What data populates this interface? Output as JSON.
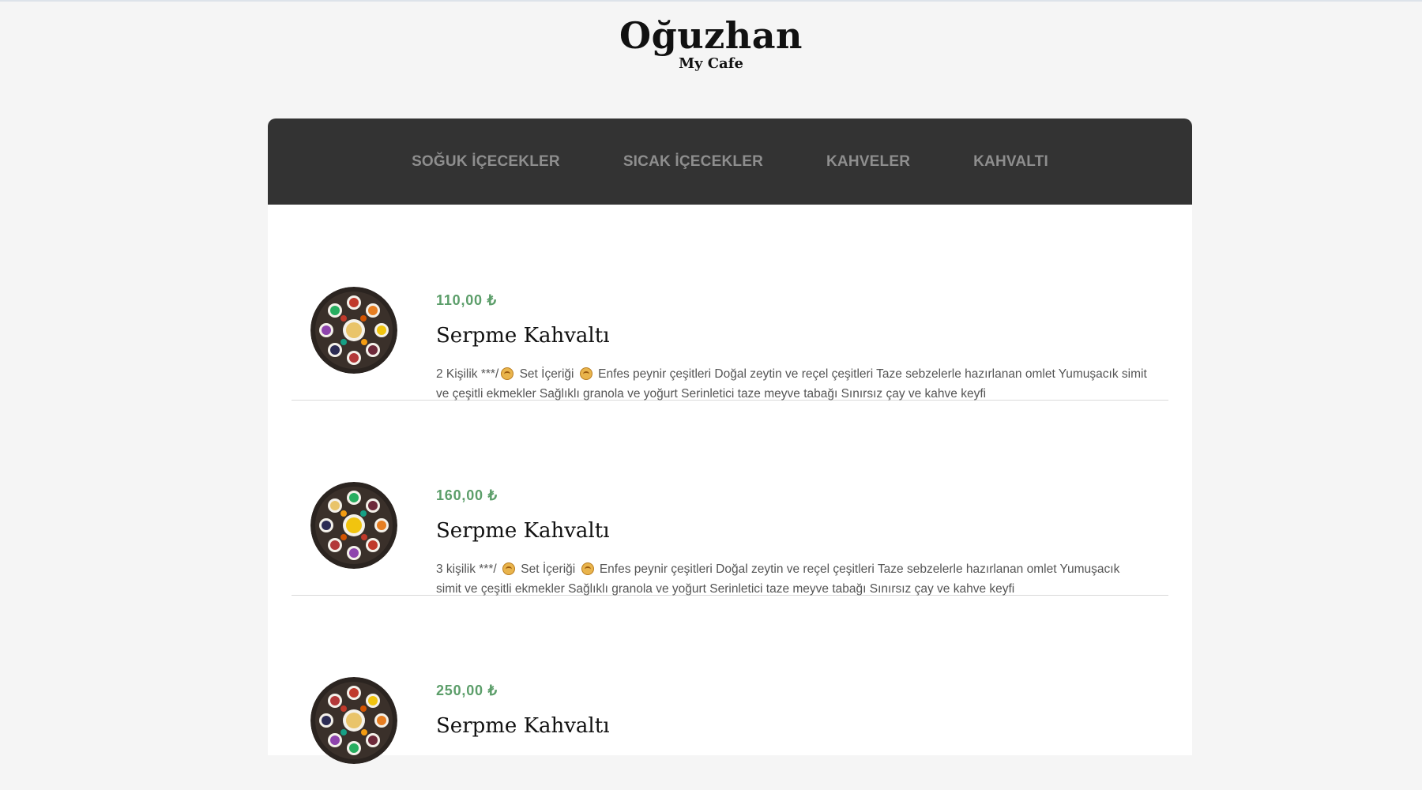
{
  "brand": {
    "title": "Oğuzhan",
    "subtitle": "My Cafe"
  },
  "nav": {
    "items": [
      {
        "label": "SOĞUK İÇECEKLER"
      },
      {
        "label": "SICAK İÇECEKLER"
      },
      {
        "label": "KAHVELER"
      },
      {
        "label": "KAHVALTI"
      }
    ]
  },
  "menu": {
    "items": [
      {
        "price": "110,00 ₺",
        "name": "Serpme Kahvaltı",
        "desc_prefix": "2 Kişilik ***/",
        "desc_mid": "Set İçeriği",
        "desc_rest": "Enfes peynir çeşitleri Doğal zeytin ve reçel çeşitleri Taze sebzelerle hazırlanan omlet Yumuşacık simit ve çeşitli ekmekler Sağlıklı granola ve yoğurt Serinletici taze meyve tabağı Sınırsız çay ve kahve keyfi",
        "image_icon": "breakfast-platter-image"
      },
      {
        "price": "160,00 ₺",
        "name": "Serpme Kahvaltı",
        "desc_prefix": "3 kişilik ***/",
        "desc_mid": "Set İçeriği",
        "desc_rest": "Enfes peynir çeşitleri Doğal zeytin ve reçel çeşitleri Taze sebzelerle hazırlanan omlet Yumuşacık simit ve çeşitli ekmekler Sağlıklı granola ve yoğurt Serinletici taze meyve tabağı Sınırsız çay ve kahve keyfi",
        "image_icon": "breakfast-platter-image"
      },
      {
        "price": "250,00 ₺",
        "name": "Serpme Kahvaltı",
        "image_icon": "breakfast-platter-image"
      }
    ]
  },
  "colors": {
    "background": "#f5f5f5",
    "nav_background": "#333333",
    "nav_text": "#8e8e8e",
    "price": "#5c9e6a",
    "description": "#555555"
  }
}
